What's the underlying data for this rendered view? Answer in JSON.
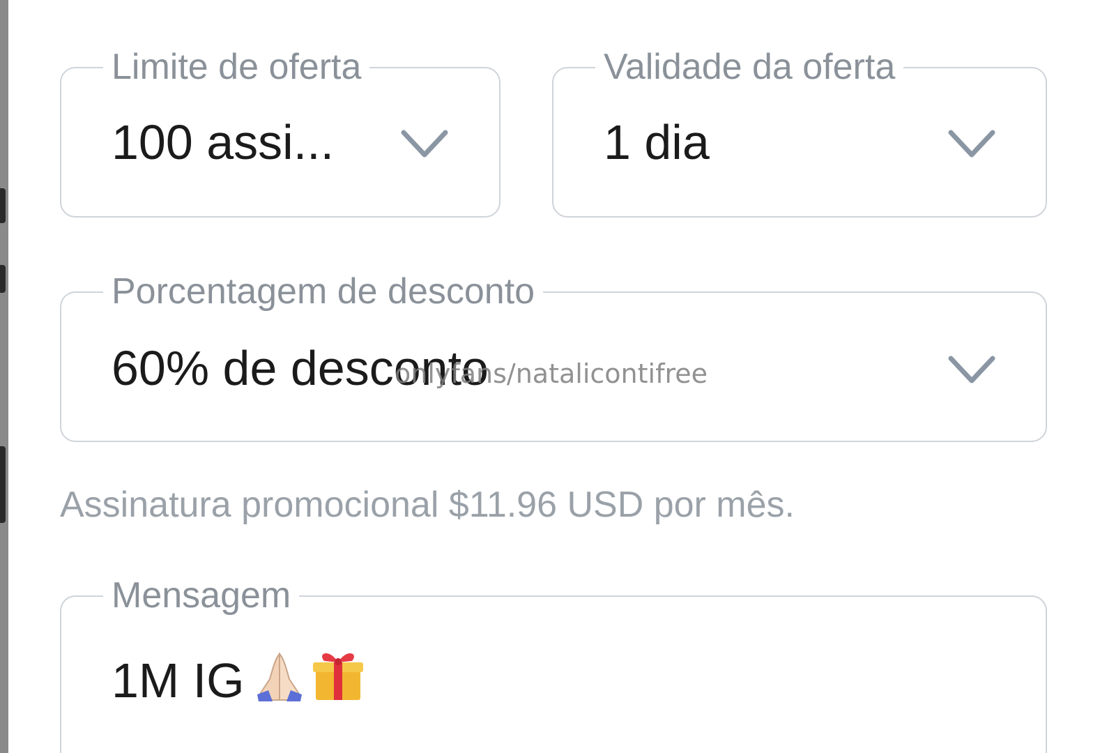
{
  "form": {
    "offer_limit": {
      "label": "Limite de oferta",
      "value": "100 assi...",
      "icon": "chevron-down-icon"
    },
    "offer_validity": {
      "label": "Validade da oferta",
      "value": "1 dia",
      "icon": "chevron-down-icon"
    },
    "discount": {
      "label": "Porcentagem de desconto",
      "value": "60% de desconto",
      "icon": "chevron-down-icon"
    },
    "promo_note": "Assinatura promocional $11.96 USD por mês.",
    "message": {
      "label": "Mensagem",
      "text": "1M IG",
      "emojis": [
        "folded-hands-icon",
        "gift-icon"
      ]
    }
  },
  "watermark": "onlyfans/natalicontifree",
  "colors": {
    "border": "#cfd4da",
    "label": "#8a9199",
    "value": "#1b1b1b",
    "helper": "#9aa1a8",
    "chevron": "#8a96a3"
  }
}
